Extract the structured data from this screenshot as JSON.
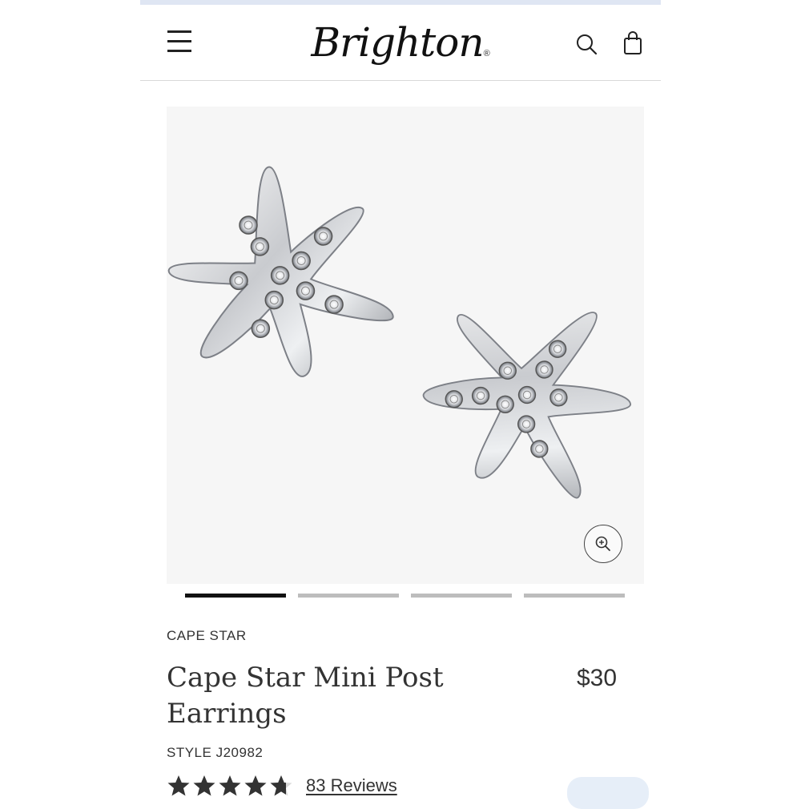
{
  "header": {
    "logo_text": "Brighton",
    "logo_mark": "®",
    "menu_icon": "hamburger-menu-icon",
    "search_icon": "search-icon",
    "bag_icon": "shopping-bag-icon"
  },
  "gallery": {
    "image_subject": "silver starfish stud earrings with crystals",
    "zoom_icon": "zoom-in-icon",
    "slide_count": 4,
    "active_slide": 1
  },
  "product": {
    "collection": "CAPE STAR",
    "title": "Cape Star Mini Post Earrings",
    "price": "$30",
    "style": "STYLE J20982",
    "rating": 4.7,
    "rating_max": 5,
    "reviews_label": "83 Reviews"
  },
  "colors": {
    "accent_strip": "#dfe6f3",
    "active_indicator": "#111111",
    "inactive_indicator": "#bdbdbd",
    "image_background": "#f6f6f6"
  }
}
